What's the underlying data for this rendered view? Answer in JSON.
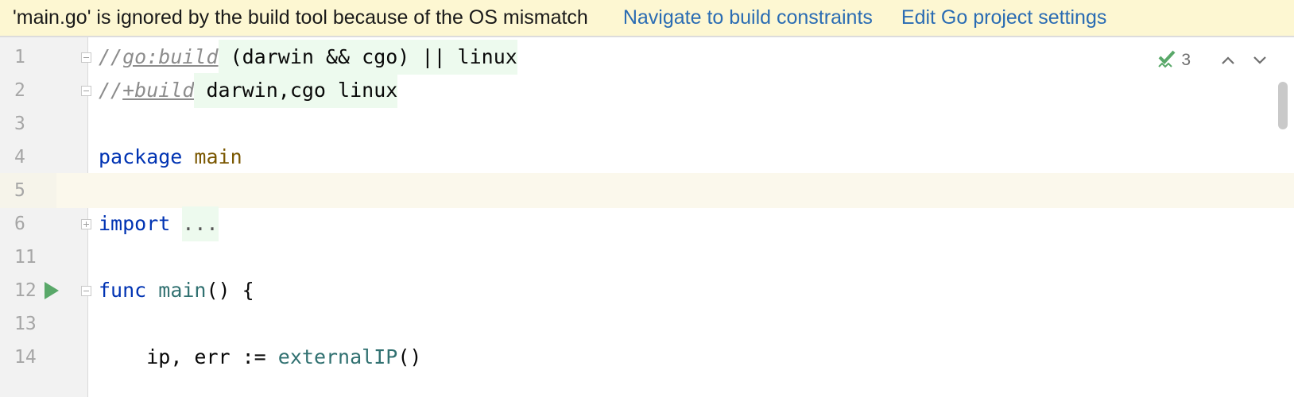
{
  "banner": {
    "message": "'main.go' is ignored by the build tool because of the OS mismatch",
    "link_navigate": "Navigate to build constraints",
    "link_settings": "Edit Go project settings"
  },
  "inspections": {
    "icon": "check-squiggle-icon",
    "count": "3",
    "prev_icon": "chevron-up-icon",
    "next_icon": "chevron-down-icon"
  },
  "lines": [
    {
      "num": "1",
      "tokens": {
        "slashes": "//",
        "directive": "go:build",
        "expr": " (darwin && cgo) || linux"
      }
    },
    {
      "num": "2",
      "tokens": {
        "slashes": "//",
        "directive": "+build",
        "expr": " darwin,cgo linux"
      }
    },
    {
      "num": "3"
    },
    {
      "num": "4",
      "tokens": {
        "kw": "package",
        "sp": " ",
        "name": "main"
      }
    },
    {
      "num": "5"
    },
    {
      "num": "6",
      "tokens": {
        "kw": "import",
        "sp": " ",
        "folded": "..."
      }
    },
    {
      "num": "11"
    },
    {
      "num": "12",
      "tokens": {
        "kw": "func",
        "sp": " ",
        "name": "main",
        "rest": "() {"
      }
    },
    {
      "num": "13"
    },
    {
      "num": "14",
      "tokens": {
        "indent": "    ",
        "pre": "ip, err := ",
        "call": "externalIP",
        "rest": "()"
      }
    }
  ],
  "colors": {
    "banner_bg": "#fdf7d2",
    "link": "#2a6cb3",
    "keyword": "#0033b3",
    "package_name": "#7a5700",
    "function": "#317171",
    "run_icon": "#59a869",
    "inspection_ok": "#59a869"
  }
}
